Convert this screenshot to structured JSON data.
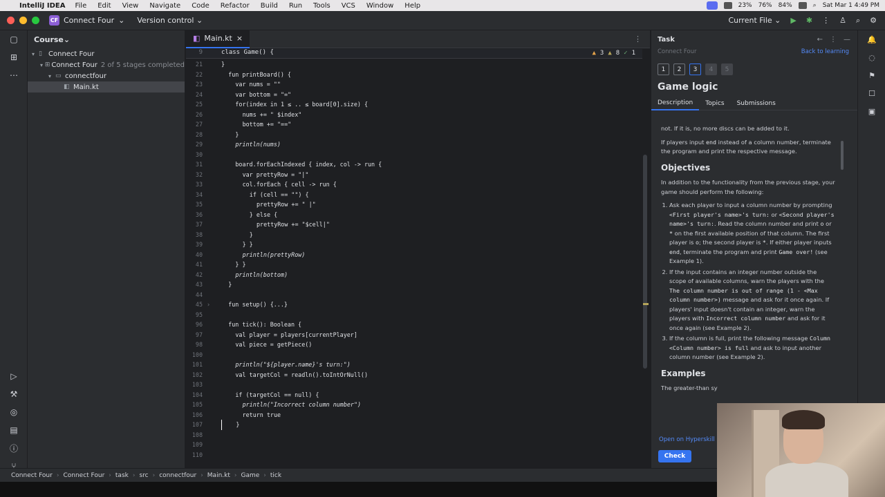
{
  "menubar": {
    "app": "IntelliJ IDEA",
    "items": [
      "File",
      "Edit",
      "View",
      "Navigate",
      "Code",
      "Refactor",
      "Build",
      "Run",
      "Tools",
      "VCS",
      "Window",
      "Help"
    ],
    "battery_cpu": "23%",
    "mem": "76%",
    "disk": "84%",
    "clock": "Sat Mar 1  4:49 PM"
  },
  "titlebar": {
    "project_badge": "CF",
    "project": "Connect Four",
    "vcs": "Version control",
    "run_config": "Current File"
  },
  "course": {
    "title": "Course",
    "tree": [
      {
        "label": "Connect Four",
        "extra": ""
      },
      {
        "label": "Connect Four",
        "extra": "2 of 5 stages completed"
      },
      {
        "label": "connectfour",
        "extra": ""
      },
      {
        "label": "Main.kt",
        "extra": ""
      }
    ]
  },
  "editor": {
    "tab": "Main.kt",
    "sticky_line": "9",
    "sticky_code": "class Game() {",
    "inspections": {
      "warnings": "3",
      "weak": "8",
      "typos": "1"
    },
    "lines": [
      {
        "n": "21",
        "c": "}"
      },
      {
        "n": "22",
        "c": "fun printBoard() {"
      },
      {
        "n": "23",
        "c": "var nums = \"\""
      },
      {
        "n": "24",
        "c": "var bottom = \"=\""
      },
      {
        "n": "25",
        "c": "for(index in 1 ≤ .. ≤ board[0].size) {"
      },
      {
        "n": "26",
        "c": "nums += \" $index\""
      },
      {
        "n": "27",
        "c": "bottom += \"==\""
      },
      {
        "n": "28",
        "c": "}"
      },
      {
        "n": "29",
        "c": "println(nums)"
      },
      {
        "n": "30",
        "c": ""
      },
      {
        "n": "31",
        "c": "board.forEachIndexed { index, col -> run {"
      },
      {
        "n": "32",
        "c": "var prettyRow = \"|\""
      },
      {
        "n": "33",
        "c": "col.forEach { cell -> run {"
      },
      {
        "n": "34",
        "c": "if (cell == \"\") {"
      },
      {
        "n": "35",
        "c": "prettyRow += \" |\""
      },
      {
        "n": "36",
        "c": "} else {"
      },
      {
        "n": "37",
        "c": "prettyRow += \"$cell|\""
      },
      {
        "n": "38",
        "c": "}"
      },
      {
        "n": "39",
        "c": "} }"
      },
      {
        "n": "40",
        "c": "println(prettyRow)"
      },
      {
        "n": "41",
        "c": "} }"
      },
      {
        "n": "42",
        "c": "println(bottom)"
      },
      {
        "n": "43",
        "c": "}"
      },
      {
        "n": "44",
        "c": ""
      },
      {
        "n": "45",
        "c": "fun setup() {...}"
      },
      {
        "n": "95",
        "c": ""
      },
      {
        "n": "96",
        "c": "fun tick(): Boolean {"
      },
      {
        "n": "97",
        "c": "val player = players[currentPlayer]"
      },
      {
        "n": "98",
        "c": "val piece = getPiece()"
      },
      {
        "n": "100",
        "c": ""
      },
      {
        "n": "101",
        "c": "println(\"${player.name}'s turn:\")"
      },
      {
        "n": "102",
        "c": "val targetCol = readln().toIntOrNull()"
      },
      {
        "n": "103",
        "c": ""
      },
      {
        "n": "104",
        "c": "if (targetCol == null) {"
      },
      {
        "n": "105",
        "c": "println(\"Incorrect column number\")"
      },
      {
        "n": "106",
        "c": "return true"
      },
      {
        "n": "107",
        "c": "}"
      },
      {
        "n": "108",
        "c": ""
      },
      {
        "n": "109",
        "c": ""
      },
      {
        "n": "110",
        "c": ""
      }
    ]
  },
  "task": {
    "header": "Task",
    "crumb": "Connect Four",
    "back": "Back to learning",
    "stages": [
      "1",
      "2",
      "3",
      "4",
      "5"
    ],
    "title": "Game logic",
    "tabs": [
      "Description",
      "Topics",
      "Submissions"
    ],
    "p_top": "not. If it is, no more discs can be added to it.",
    "p_end_a": "If players input",
    "p_end_code": "end",
    "p_end_b": "instead of a column number, terminate the program and print the respective message.",
    "objectives_title": "Objectives",
    "objectives_intro": "In addition to the functionality from the previous stage, your game should perform the following:",
    "obj1_a": "Ask each player to input a column number by prompting",
    "obj1_code1": "<First player's name>'s turn:",
    "obj1_b": "or",
    "obj1_code2": "<Second player's name>'s turn:",
    "obj1_c": ". Read the column number and print",
    "obj1_code3": "o",
    "obj1_d": "or",
    "obj1_code4": "*",
    "obj1_e": "on the first available position of that column. The first player is",
    "obj1_code5": "o",
    "obj1_f": "; the second player is",
    "obj1_code6": "*",
    "obj1_g": ". If either player inputs",
    "obj1_code7": "end",
    "obj1_h": ", terminate the program and print",
    "obj1_code8": "Game over!",
    "obj1_i": "(see Example 1).",
    "obj2_a": "If the input contains an integer number outside the scope of available columns, warn the players with the",
    "obj2_code1": "The column number is out of range (1 - <Max column number>)",
    "obj2_b": "message and ask for it once again. If players' input doesn't contain an integer, warn the players with",
    "obj2_code2": "Incorrect column number",
    "obj2_c": "and ask for it once again (see Example 2).",
    "obj3_a": "If the column is full, print the following message",
    "obj3_code": "Column <Column number> is full",
    "obj3_b": "and ask to input another column number (see Example 2).",
    "examples_title": "Examples",
    "examples_text": "The greater-than sy",
    "open_link": "Open on Hyperskill ↗",
    "check": "Check"
  },
  "status": {
    "crumbs": [
      "Connect Four",
      "Connect Four",
      "task",
      "src",
      "connectfour",
      "Main.kt",
      "Game",
      "tick"
    ]
  }
}
